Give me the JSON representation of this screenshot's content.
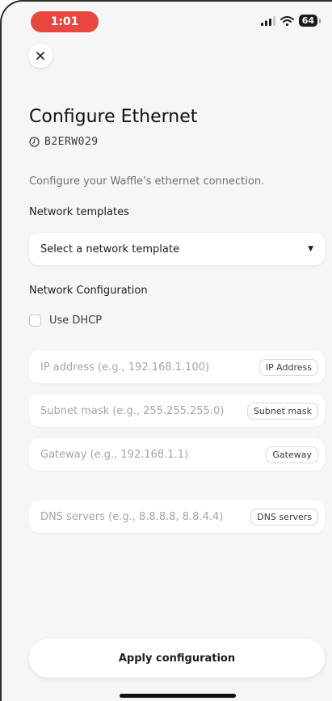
{
  "status_bar": {
    "time": "1:01",
    "battery": "64"
  },
  "header": {
    "title": "Configure Ethernet",
    "device_id": "B2ERW029"
  },
  "description": "Configure your Waffle's ethernet connection.",
  "templates": {
    "label": "Network templates",
    "selected": "Select a network template",
    "arrow": "▼"
  },
  "network_config": {
    "label": "Network Configuration",
    "dhcp_label": "Use DHCP",
    "dhcp_checked": false,
    "fields": [
      {
        "placeholder": "IP address (e.g., 192.168.1.100)",
        "tag": "IP Address"
      },
      {
        "placeholder": "Subnet mask (e.g., 255.255.255.0)",
        "tag": "Subnet mask"
      },
      {
        "placeholder": "Gateway (e.g., 192.168.1.1)",
        "tag": "Gateway"
      },
      {
        "placeholder": "DNS servers (e.g., 8.8.8.8, 8.8.4.4)",
        "tag": "DNS servers"
      }
    ]
  },
  "actions": {
    "apply_label": "Apply configuration"
  },
  "colors": {
    "time_pill": "#e8473f",
    "background": "#f6f6f7"
  }
}
